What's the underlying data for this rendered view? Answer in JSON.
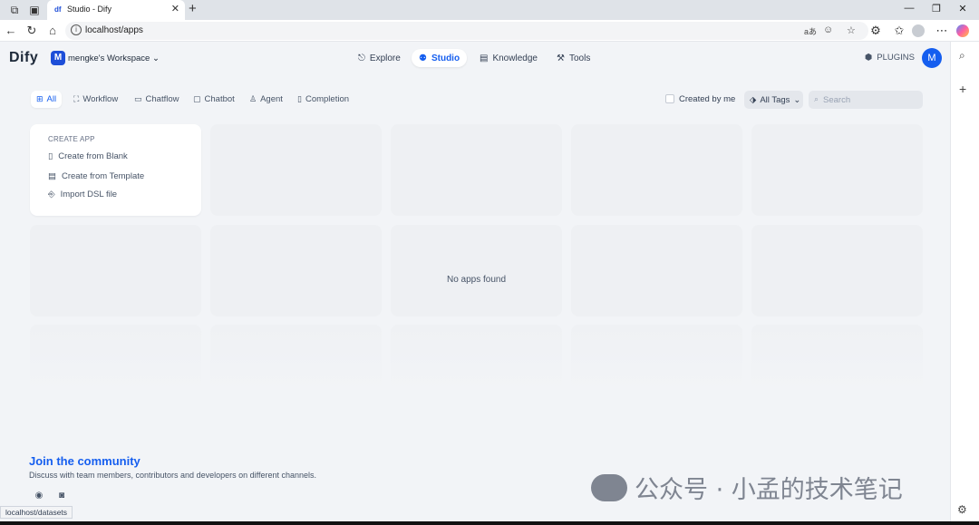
{
  "browser": {
    "tab_title": "Studio - Dify",
    "tab_favicon": "df",
    "url": "localhost/apps",
    "translate_label": "aあ",
    "status_url": "localhost/datasets"
  },
  "header": {
    "logo": "Dify",
    "workspace_initial": "M",
    "workspace_name": "mengke's Workspace",
    "nav": [
      {
        "label": "Explore"
      },
      {
        "label": "Studio"
      },
      {
        "label": "Knowledge"
      },
      {
        "label": "Tools"
      }
    ],
    "plugins_label": "PLUGINS",
    "avatar_initial": "M"
  },
  "filters": {
    "tabs": [
      {
        "label": "All"
      },
      {
        "label": "Workflow"
      },
      {
        "label": "Chatflow"
      },
      {
        "label": "Chatbot"
      },
      {
        "label": "Agent"
      },
      {
        "label": "Completion"
      }
    ],
    "created_by_me": "Created by me",
    "all_tags": "All Tags",
    "search_placeholder": "Search"
  },
  "create_app": {
    "title": "CREATE APP",
    "items": [
      {
        "label": "Create from Blank"
      },
      {
        "label": "Create from Template"
      },
      {
        "label": "Import DSL file"
      }
    ]
  },
  "empty_message": "No apps found",
  "community": {
    "title": "Join the community",
    "subtitle": "Discuss with team members, contributors and developers on different channels."
  },
  "watermark": "公众号 · 小孟的技术笔记",
  "colors": {
    "accent": "#155eef",
    "background": "#f2f4f7"
  }
}
